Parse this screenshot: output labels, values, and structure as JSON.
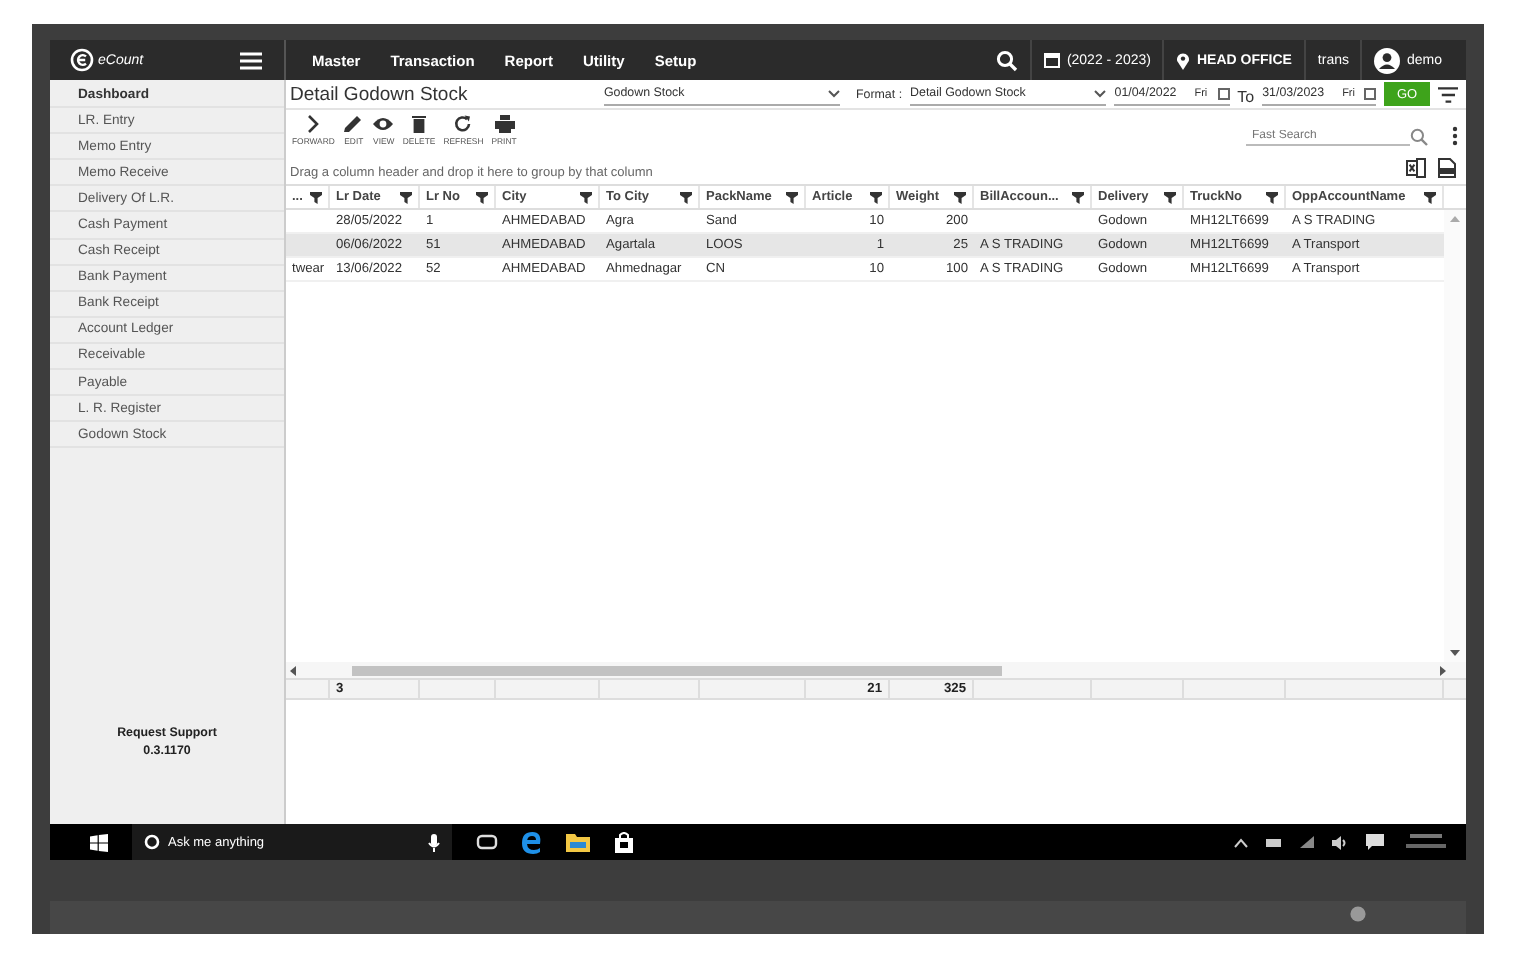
{
  "header": {
    "logo": "eCount",
    "nav": [
      "Master",
      "Transaction",
      "Report",
      "Utility",
      "Setup"
    ],
    "year": "(2022 - 2023)",
    "office": "HEAD OFFICE",
    "company": "trans",
    "user": "demo"
  },
  "sidebar": {
    "items": [
      {
        "label": "Dashboard",
        "selected": true
      },
      {
        "label": "LR. Entry",
        "selected": false
      },
      {
        "label": "Memo Entry",
        "selected": false
      },
      {
        "label": "Memo Receive",
        "selected": false
      },
      {
        "label": "Delivery Of L.R.",
        "selected": false
      },
      {
        "label": "Cash Payment",
        "selected": false
      },
      {
        "label": "Cash Receipt",
        "selected": false
      },
      {
        "label": "Bank Payment",
        "selected": false
      },
      {
        "label": "Bank Receipt",
        "selected": false
      },
      {
        "label": "Account Ledger",
        "selected": false
      },
      {
        "label": "Receivable",
        "selected": false
      },
      {
        "label": "Payable",
        "selected": false
      },
      {
        "label": "L. R. Register",
        "selected": false
      },
      {
        "label": "Godown Stock",
        "selected": false
      }
    ],
    "support": "Request Support",
    "version": "0.3.1170"
  },
  "page": {
    "title": "Detail Godown Stock",
    "report": "Godown Stock",
    "format_label": "Format :",
    "format": "Detail Godown Stock",
    "from_date": "01/04/2022",
    "from_day": "Fri",
    "to_label": "To",
    "to_date": "31/03/2023",
    "to_day": "Fri",
    "go": "GO"
  },
  "toolbar": [
    {
      "kind": "forward",
      "label": "FORWARD"
    },
    {
      "kind": "edit",
      "label": "EDIT"
    },
    {
      "kind": "view",
      "label": "VIEW"
    },
    {
      "kind": "delete",
      "label": "DELETE"
    },
    {
      "kind": "refresh",
      "label": "REFRESH"
    },
    {
      "kind": "print",
      "label": "PRINT"
    }
  ],
  "search": {
    "placeholder": "Fast Search"
  },
  "grid": {
    "group_hint": "Drag a column header and drop it here to group by that column",
    "columns": [
      {
        "label": "...",
        "kind": "text"
      },
      {
        "label": "Lr Date",
        "kind": "text",
        "total": "3"
      },
      {
        "label": "Lr No",
        "kind": "text"
      },
      {
        "label": "City",
        "kind": "text"
      },
      {
        "label": "To City",
        "kind": "text"
      },
      {
        "label": "PackName",
        "kind": "text"
      },
      {
        "label": "Article",
        "kind": "number",
        "total": "21"
      },
      {
        "label": "Weight",
        "kind": "number",
        "total": "325"
      },
      {
        "label": "BillAccoun...",
        "kind": "text"
      },
      {
        "label": "Delivery",
        "kind": "text"
      },
      {
        "label": "TruckNo",
        "kind": "text"
      },
      {
        "label": "OppAccountName",
        "kind": "text"
      }
    ],
    "rows": [
      {
        "selected": false,
        "cells": [
          null,
          "28/05/2022",
          "1",
          "AHMEDABAD",
          "Agra",
          "Sand",
          "10",
          "200",
          null,
          "Godown",
          "MH12LT6699",
          "A S TRADING"
        ]
      },
      {
        "selected": true,
        "cells": [
          null,
          "06/06/2022",
          "51",
          "AHMEDABAD",
          "Agartala",
          "LOOS",
          "1",
          "25",
          "A S TRADING",
          "Godown",
          "MH12LT6699",
          "A Transport"
        ]
      },
      {
        "selected": false,
        "cells": [
          "twear",
          "13/06/2022",
          "52",
          "AHMEDABAD",
          "Ahmednagar",
          "CN",
          "10",
          "100",
          "A S TRADING",
          "Godown",
          "MH12LT6699",
          "A Transport"
        ]
      }
    ]
  },
  "taskbar": {
    "search": "Ask me anything"
  }
}
